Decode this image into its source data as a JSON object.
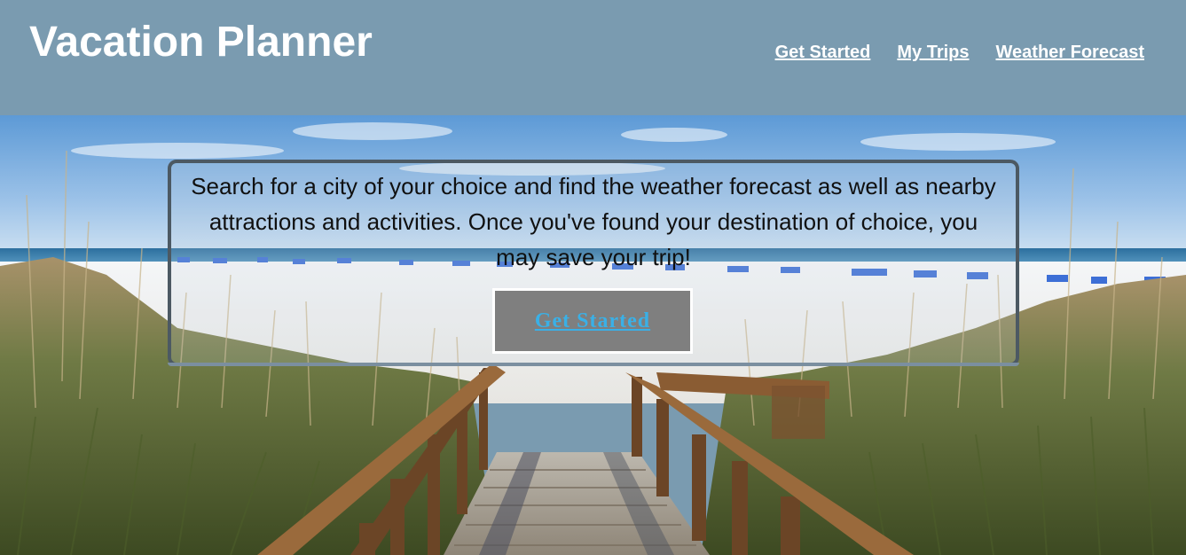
{
  "header": {
    "title": "Vacation Planner",
    "nav": [
      {
        "label": "Get Started"
      },
      {
        "label": "My Trips"
      },
      {
        "label": "Weather Forecast"
      }
    ]
  },
  "hero": {
    "description": "Search for a city of your choice and find the weather forecast as well as nearby attractions and activities. Once you've found your destination of choice, you may save your trip!",
    "cta_label": "Get Started"
  },
  "colors": {
    "header_bg": "#7a9bb0",
    "cta_bg": "#7f7f7f",
    "cta_text": "#3ab0e6"
  },
  "icons": {
    "background": "beach-boardwalk-photo"
  }
}
